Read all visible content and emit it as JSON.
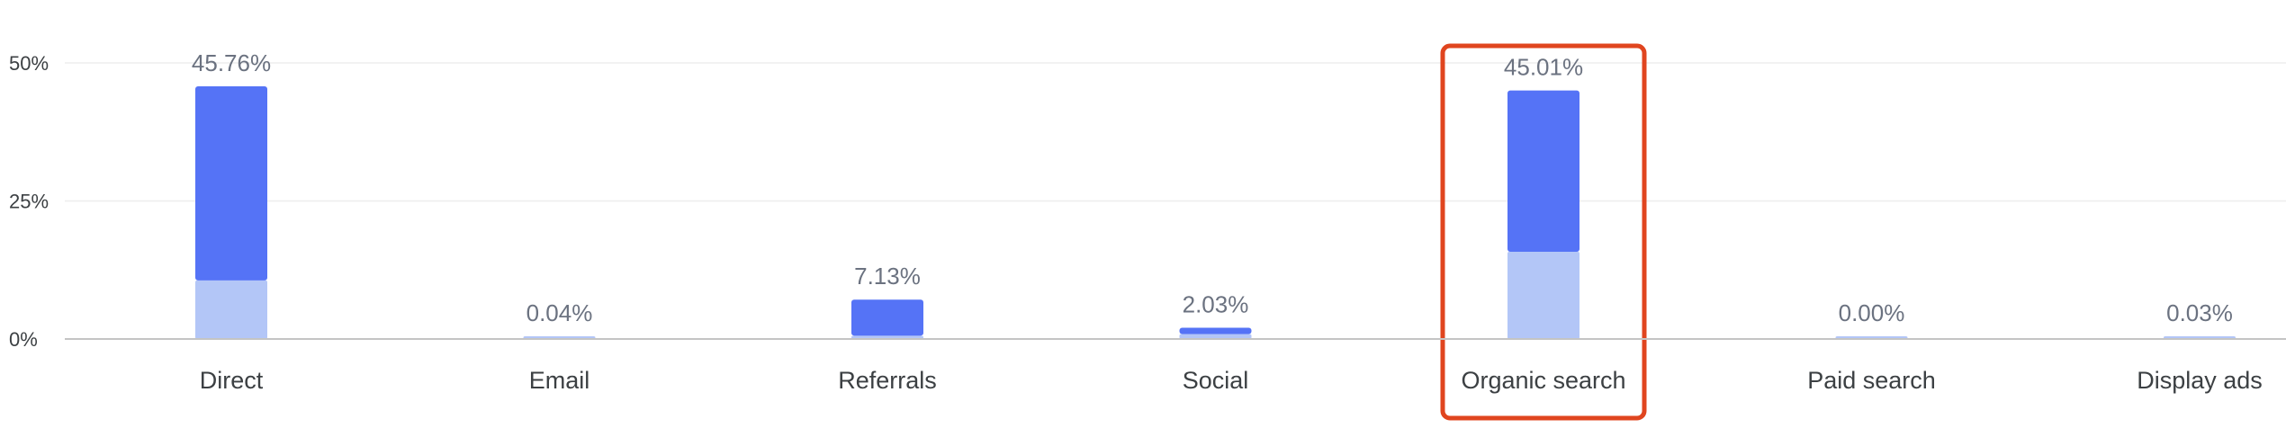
{
  "chart_data": {
    "type": "bar",
    "stacked": true,
    "categories": [
      "Direct",
      "Email",
      "Referrals",
      "Social",
      "Organic search",
      "Paid search",
      "Display ads"
    ],
    "totals_labels": [
      "45.76%",
      "0.04%",
      "7.13%",
      "2.03%",
      "45.01%",
      "0.00%",
      "0.03%"
    ],
    "series": [
      {
        "values": [
          10.6,
          0.04,
          0.6,
          0.9,
          15.8,
          0.0,
          0.03
        ]
      },
      {
        "values": [
          35.16,
          0.0,
          6.53,
          1.13,
          29.21,
          0.0,
          0.0
        ]
      }
    ],
    "colors": {
      "dark_segment": "#5573f6",
      "light_segment": "#b3c6f7",
      "highlight": "#e0451f",
      "grid": "#eeeeee",
      "axis": "#c4c4c4"
    },
    "y_ticks": [
      {
        "value": 0,
        "label": "0%"
      },
      {
        "value": 25,
        "label": "25%"
      },
      {
        "value": 50,
        "label": "50%"
      }
    ],
    "ylim": [
      0,
      50
    ],
    "grid": true,
    "highlighted_category": "Organic search"
  }
}
